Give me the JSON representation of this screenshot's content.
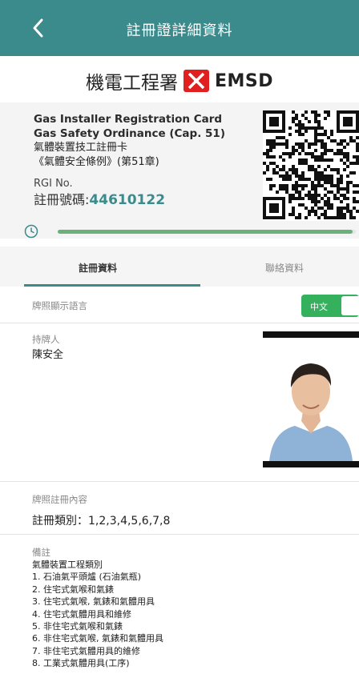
{
  "header": {
    "title": "註冊證詳細資料"
  },
  "logo": {
    "zh": "機電工程署",
    "en": "EMSD"
  },
  "card": {
    "title_en_1": "Gas Installer Registration Card",
    "title_en_2": "Gas Safety Ordinance (Cap. 51)",
    "title_zh_1": "氣體裝置技工註冊卡",
    "title_zh_2": "《氣體安全條例》(第51章)",
    "rgi_label": "RGI No.",
    "reg_label": "註冊號碼:",
    "reg_number": "44610122"
  },
  "progress": {
    "fraction": 0.99
  },
  "tabs": [
    {
      "label": "註冊資料"
    },
    {
      "label": "聯絡資料"
    }
  ],
  "language": {
    "label": "牌照顯示語言",
    "toggle_label": "中文"
  },
  "holder": {
    "label": "持牌人",
    "name": "陳安全"
  },
  "license": {
    "label": "牌照註冊內容",
    "types": "註冊類別：1,2,3,4,5,6,7,8"
  },
  "notes": {
    "label": "備註",
    "items": [
      "氣體裝置工程類別",
      "1. 石油氣平頭爐 (石油氣瓶)",
      "2. 住宅式氣喉和氣錶",
      "3. 住宅式氣喉, 氣錶和氣體用具",
      "4. 住宅式氣體用具和維修",
      "5. 非住宅式氣喉和氣錶",
      "6. 非住宅式氣喉, 氣錶和氣體用具",
      "7. 非住宅式氣體用具的維修",
      "8. 工業式氣體用具(工序)"
    ]
  },
  "colors": {
    "accent": "#3b8a8c",
    "toggle": "#35b05d",
    "progress": "#6bb27a"
  }
}
